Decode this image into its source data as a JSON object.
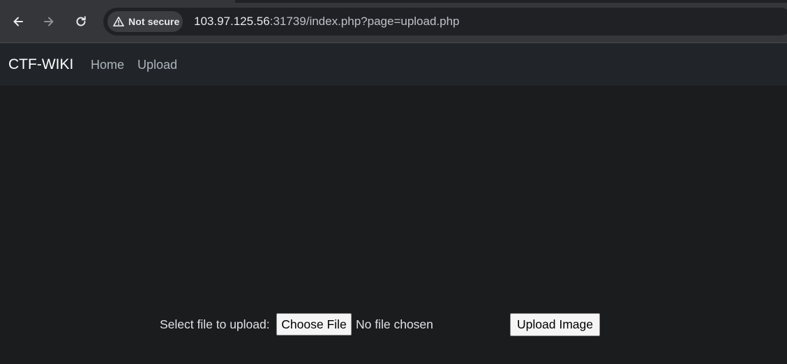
{
  "browser": {
    "security_label": "Not secure",
    "url_host": "103.97.125.56",
    "url_rest": ":31739/index.php?page=upload.php",
    "icons": {
      "back": "back-arrow-icon",
      "forward": "forward-arrow-icon",
      "reload": "reload-icon",
      "security": "warning-triangle-icon"
    }
  },
  "site_nav": {
    "brand": "CTF-WIKI",
    "links": [
      "Home",
      "Upload"
    ]
  },
  "upload_form": {
    "label": "Select file to upload:",
    "choose_button": "Choose File",
    "file_status": "No file chosen",
    "submit_button": "Upload Image"
  },
  "colors": {
    "page_background": "#1b1c1e",
    "navbar_background": "#212529",
    "browser_toolbar": "#35363a",
    "nav_link": "#adb5bd"
  }
}
